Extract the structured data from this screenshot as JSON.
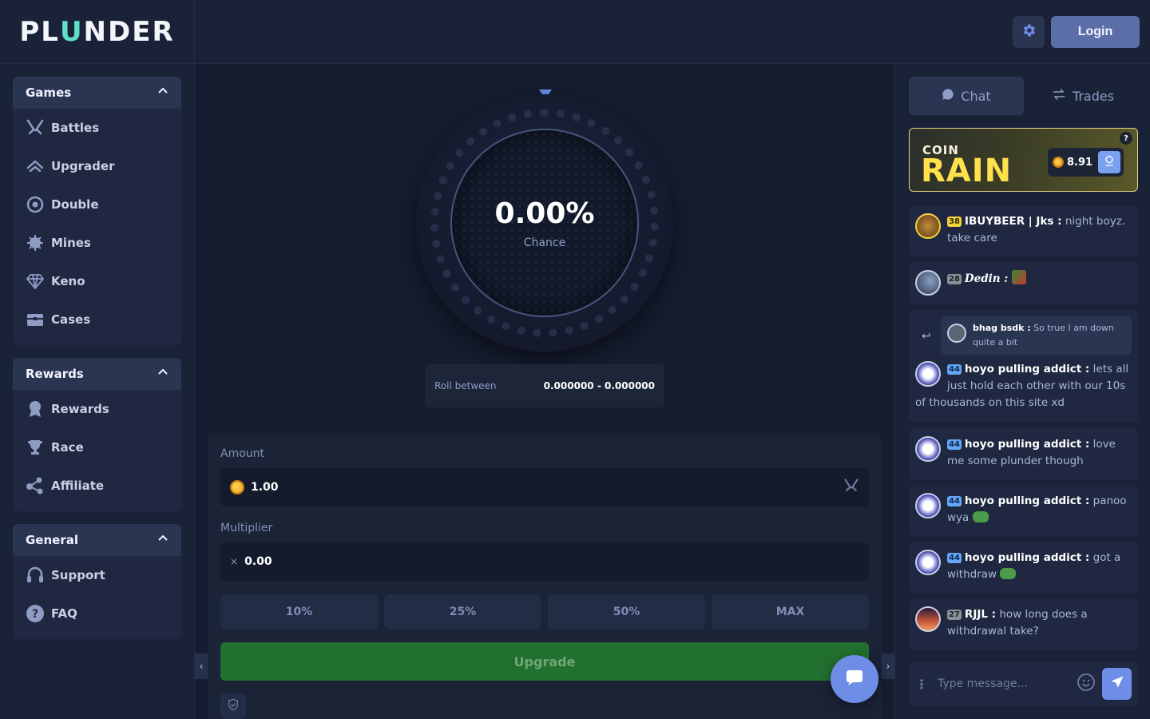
{
  "brand": {
    "logo_text_left": "PL",
    "logo_text_mid": "U",
    "logo_text_right": "NDER"
  },
  "header": {
    "login_label": "Login"
  },
  "sidebar": {
    "games": {
      "title": "Games",
      "items": [
        {
          "label": "Battles",
          "icon": "swords-icon"
        },
        {
          "label": "Upgrader",
          "icon": "upgrader-icon"
        },
        {
          "label": "Double",
          "icon": "double-icon"
        },
        {
          "label": "Mines",
          "icon": "mine-icon"
        },
        {
          "label": "Keno",
          "icon": "diamond-icon"
        },
        {
          "label": "Cases",
          "icon": "chest-icon"
        }
      ]
    },
    "rewards": {
      "title": "Rewards",
      "items": [
        {
          "label": "Rewards",
          "icon": "medal-icon"
        },
        {
          "label": "Race",
          "icon": "trophy-icon"
        },
        {
          "label": "Affiliate",
          "icon": "share-icon"
        }
      ]
    },
    "general": {
      "title": "General",
      "items": [
        {
          "label": "Support",
          "icon": "headset-icon"
        },
        {
          "label": "FAQ",
          "icon": "question-icon"
        }
      ]
    }
  },
  "upgrader": {
    "chance_value": "0.00%",
    "chance_label": "Chance",
    "roll_label": "Roll between",
    "roll_value": "0.000000 - 0.000000",
    "amount_label": "Amount",
    "amount_value": "1.00",
    "multiplier_label": "Multiplier",
    "multiplier_prefix": "×",
    "multiplier_value": "0.00",
    "percent_buttons": [
      "10%",
      "25%",
      "50%",
      "MAX"
    ],
    "upgrade_label": "Upgrade"
  },
  "chat": {
    "tabs": {
      "chat": "Chat",
      "trades": "Trades"
    },
    "rain": {
      "coin": "COIN",
      "rain": "RAIN",
      "amount": "8.91",
      "help": "?"
    },
    "messages": [
      {
        "level": "38",
        "user": "IBUYBEER | Jks :",
        "text": "night boyz. take care"
      },
      {
        "level": "28",
        "user": "Dedin :",
        "text": ""
      },
      {
        "reply_user": "bhag bsdk :",
        "reply_text": "So true I am down quite a bit",
        "level": "44",
        "user": "hoyo pulling addict :",
        "text": "lets all just hold each other with our 10s of thousands on this site xd"
      },
      {
        "level": "44",
        "user": "hoyo pulling addict :",
        "text": "love me some plunder though"
      },
      {
        "level": "44",
        "user": "hoyo pulling addict :",
        "text": "panoo wya"
      },
      {
        "level": "44",
        "user": "hoyo pulling addict :",
        "text": "got a withdraw"
      },
      {
        "level": "27",
        "user": "RJJL :",
        "text": "how long does a withdrawal take?"
      }
    ],
    "input_placeholder": "Type message..."
  },
  "colors": {
    "accent": "#6d8de6",
    "upgrade_green": "#22702f",
    "rain_yellow": "#ffe14c"
  }
}
